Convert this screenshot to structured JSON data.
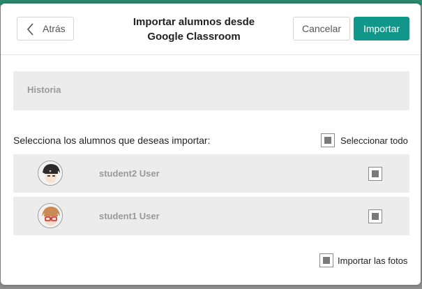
{
  "background": {
    "corner_text": "Seleccionar todo"
  },
  "header": {
    "back_label": "Atrás",
    "title_line1": "Importar alumnos desde",
    "title_line2": "Google Classroom",
    "cancel_label": "Cancelar",
    "import_label": "Importar"
  },
  "class_name": "Historia",
  "select_heading": "Selecciona los alumnos que deseas importar:",
  "select_all_label": "Seleccionar todo",
  "students": [
    {
      "name": "student2 User",
      "checked": true
    },
    {
      "name": "student1 User",
      "checked": true
    }
  ],
  "import_photos_label": "Importar las fotos",
  "colors": {
    "accent": "#11978a",
    "row_bg": "#ececec"
  }
}
